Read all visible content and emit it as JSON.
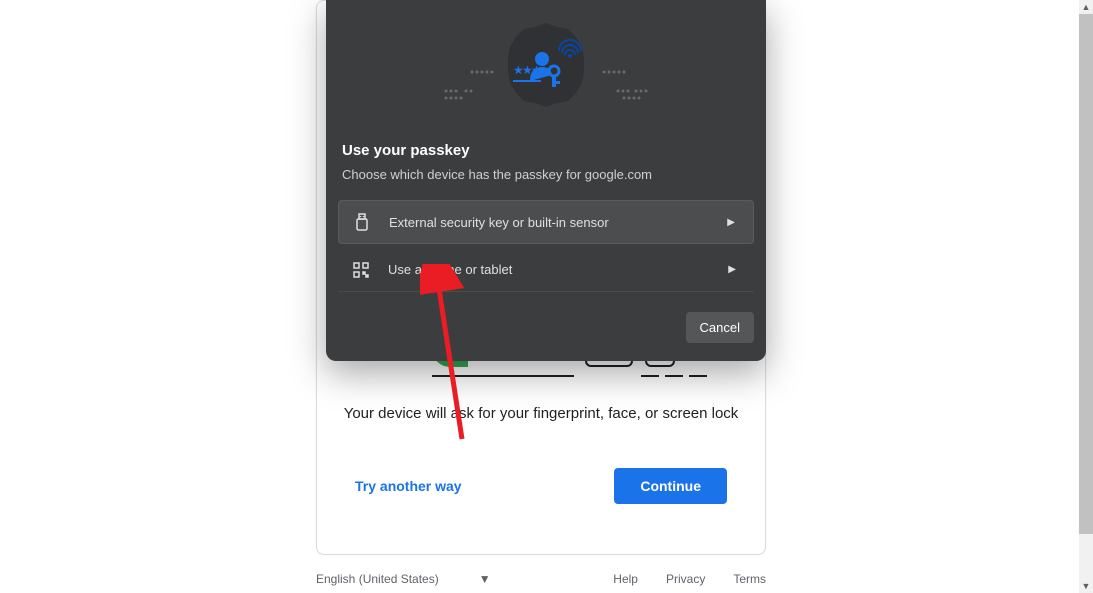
{
  "card": {
    "helper_text": "Your device will ask for your fingerprint, face, or screen lock",
    "try_another_label": "Try another way",
    "continue_label": "Continue"
  },
  "modal": {
    "title": "Use your passkey",
    "subtitle": "Choose which device has the passkey for google.com",
    "options": [
      {
        "label": "External security key or built-in sensor",
        "icon": "usb-icon",
        "selected": true
      },
      {
        "label": "Use a phone or tablet",
        "icon": "qr-icon",
        "selected": false
      }
    ],
    "cancel_label": "Cancel"
  },
  "footer": {
    "language": "English (United States)",
    "links": [
      "Help",
      "Privacy",
      "Terms"
    ]
  },
  "annotation": {
    "arrow_color": "#ea1c24"
  }
}
